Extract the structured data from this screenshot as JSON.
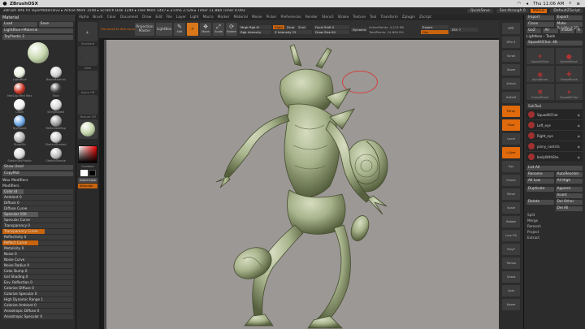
{
  "macbar": {
    "app_name": "ZBrushOSX",
    "time": "Thu 11:06 AM"
  },
  "zbar": {
    "info": "ZBrush 4R6 P2   layerMaterialv2   ▸ Active Mem 1540 ▸ Scratch Disk 1249 ▸ Free Mem 1447 ▸ ZTime 2.528 ▸ Timer 11.884 Timer 0.093",
    "quicksave": "QuickSave",
    "see_through": "See-through 0",
    "menus": "Menus",
    "default_script": "DefaultZScript"
  },
  "menu_items": [
    "Alpha",
    "Brush",
    "Color",
    "Document",
    "Draw",
    "Edit",
    "File",
    "Layer",
    "Light",
    "Macro",
    "Marker",
    "Material",
    "Movie",
    "Picker",
    "Preferences",
    "Render",
    "Stencil",
    "Stroke",
    "Texture",
    "Tool",
    "Transform",
    "Zplugin",
    "Zscript"
  ],
  "left": {
    "panel_title": "Material",
    "load": "Load",
    "save": "Save",
    "current_material": "LightBlue+Material",
    "shaders_label": "ToyPlastic 2",
    "materials": [
      {
        "name": "LightBlue",
        "color": "#e8f0dc"
      },
      {
        "name": "BasicMaterial",
        "color": "#d0d0d0"
      },
      {
        "name": "MatCap Red Wax",
        "color": "#c83020"
      },
      {
        "name": "Toon",
        "color": "#3a3a3a"
      },
      {
        "name": "Chalk",
        "color": "#f0f0f0"
      },
      {
        "name": "SkinShade4",
        "color": "#d8d8d8"
      },
      {
        "name": "ToyPlastic",
        "color": "#6aa7e8"
      },
      {
        "name": "ReflectedMap",
        "color": "#9a9a9a"
      },
      {
        "name": "ShowTol",
        "color": "#b0b0b0"
      },
      {
        "name": "SketchShaded",
        "color": "#c8c8c8"
      },
      {
        "name": "SketchToyPlastic",
        "color": "#d8d8d8"
      },
      {
        "name": "SketchSimple",
        "color": "#bbbbbb"
      }
    ],
    "show_used": "Show Used",
    "copymat": "CopyMat",
    "paste": "PasteMat",
    "wax_modifiers": "Wax Modifiers",
    "modifiers": "Modifiers",
    "sliders": [
      {
        "label": "Color Id",
        "fill": 0.3,
        "hl": false
      },
      {
        "label": "Ambient 0",
        "fill": 0.0,
        "hl": false
      },
      {
        "label": "Diffuse 0",
        "fill": 0.0,
        "hl": false
      },
      {
        "label": "Diffuse Curve",
        "fill": 0.0,
        "hl": false
      },
      {
        "label": "Specular 100",
        "fill": 0.5,
        "hl": false
      },
      {
        "label": "Specular Curve",
        "fill": 0.0,
        "hl": false
      },
      {
        "label": "Transparency 0",
        "fill": 0.0,
        "hl": false
      },
      {
        "label": "Transparency Curve",
        "fill": 0.6,
        "hl": true
      },
      {
        "label": "Reflectivity 0",
        "fill": 0.0,
        "hl": false
      },
      {
        "label": "Reflect Curve",
        "fill": 0.5,
        "hl": true
      },
      {
        "label": "Metalicity 0",
        "fill": 0.0,
        "hl": false
      },
      {
        "label": "Noise 0",
        "fill": 0.0,
        "hl": false
      },
      {
        "label": "Noise Curve",
        "fill": 0.0,
        "hl": false
      },
      {
        "label": "Noise Radius 0",
        "fill": 0.0,
        "hl": false
      },
      {
        "label": "Color Bump 0",
        "fill": 0.0,
        "hl": false
      },
      {
        "label": "Gel Shading 0",
        "fill": 0.0,
        "hl": false
      },
      {
        "label": "Env. Reflection 0",
        "fill": 0.0,
        "hl": false
      },
      {
        "label": "Colorize Diffuse 0",
        "fill": 0.0,
        "hl": false
      },
      {
        "label": "Colorize Specular 0",
        "fill": 0.0,
        "hl": false
      },
      {
        "label": "High Dynamic Range 1",
        "fill": 0.0,
        "hl": false
      },
      {
        "label": "Colorize Ambient 0",
        "fill": 0.0,
        "hl": false
      },
      {
        "label": "Anisotropic Diffuse 0",
        "fill": 0.0,
        "hl": false
      },
      {
        "label": "Anisotropic Specular 0",
        "fill": 0.0,
        "hl": false
      }
    ]
  },
  "shelf": {
    "notice": "File saved to disk successfully.",
    "projection_master": "Projection Master",
    "lightbox": "LightBox",
    "quick_sketch": "Quick Sketch",
    "edit": "Edit",
    "draw": "Draw",
    "move": "Move",
    "scale": "Scale",
    "rotate": "Rotate",
    "mrgb": "Mrgb",
    "rgb": "Rgb",
    "m": "M",
    "rgb_intensity": "Rgb Intensity",
    "zadd": "Zadd",
    "zsub": "Zsub",
    "zcut": "Zcut",
    "z_intensity": "Z Intensity 25",
    "focal_shift": "Focal Shift 0",
    "draw_size": "Draw Size 64",
    "dynamic": "Dynamic",
    "active_points": "ActivePoints: 4,219 Mil",
    "total_points": "TotalPoints: 24.664 Mil",
    "export": "Export",
    "ssv": "SSV 7",
    "grp": "Grp"
  },
  "toolstrip": {
    "slot1": "Standard",
    "slot2": "Dots",
    "slot3": "Alpha Off",
    "slot4": "Texture Off",
    "slot5": "",
    "gradient": "Gradient",
    "switch_color": "SwitchColor",
    "alternate": "Alternate"
  },
  "rstrip": [
    "BPR",
    "SPix 3",
    "Scroll",
    "Zoom",
    "Actual",
    "AAHalf",
    "Persp",
    "Floor",
    "Local",
    "L.Sym",
    "Xyz",
    "Frame",
    "Move",
    "Scale",
    "Rotate",
    "Line Fill",
    "PolyF",
    "Transp",
    "Ghost",
    "Solo",
    "Xpose"
  ],
  "right": {
    "import": "Import",
    "export": "Export",
    "clone": "Clone",
    "make_polymesh": "Make PolyMesh3D",
    "goz": "GoZ",
    "all": "All",
    "visible": "Visible",
    "r": "R",
    "lightbox_tools": "Lightbox › Tools",
    "tool_name": "SquadAlChar. 48",
    "tools": [
      {
        "name": "SquadAlChar",
        "icon": "✦"
      },
      {
        "name": "SphereBrush",
        "icon": "●"
      },
      {
        "name": "AlphaBrush",
        "icon": "◉"
      },
      {
        "name": "SimpleBrush",
        "icon": "✚"
      },
      {
        "name": "EraserBrush",
        "icon": "✖"
      },
      {
        "name": "SquadAlChar",
        "icon": "✦"
      }
    ],
    "subtool_head": "SubTool",
    "subtools": [
      "SquadAlChar",
      "Left_eye",
      "Right_eye",
      "pinny_nostrils",
      "bodyWithShe"
    ],
    "list_all": "List All",
    "rename": "Rename",
    "autoreorder": "AutoReorder",
    "all_low": "All Low",
    "all_high": "All High",
    "duplicate": "Duplicate",
    "append": "Append",
    "insert": "Insert",
    "delete": "Delete",
    "del_other": "Del Other",
    "del_all": "Del All",
    "split": "Split",
    "merge": "Merge",
    "remesh": "Remesh",
    "project": "Project",
    "extract": "Extract"
  },
  "colors": {
    "accent": "#e06a0c",
    "canvas_bg": "#9c9895",
    "model": "#a8b48c"
  }
}
